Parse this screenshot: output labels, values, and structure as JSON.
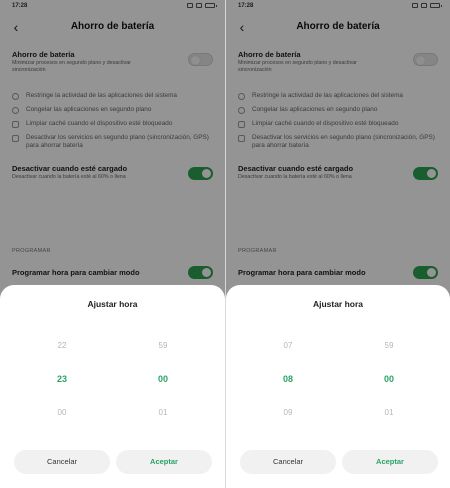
{
  "screens": [
    {
      "status_time": "17:28",
      "title": "Ahorro de batería",
      "setting_main": {
        "title": "Ahorro de batería",
        "subtitle": "Minimizar procesos en segundo plano y desactivar sincronización",
        "enabled": false
      },
      "features": [
        "Restringe la actividad de las aplicaciones del sistema",
        "Congelar las aplicaciones en segundo plano",
        "Limpiar caché cuando el dispositivo esté bloqueado",
        "Desactivar los servicios en segundo plano (sincronización, GPS) para ahorrar batería"
      ],
      "charged": {
        "title": "Desactivar cuando esté cargado",
        "subtitle": "Desactivar cuando la batería esté al 60% o llena",
        "enabled": true
      },
      "section": "PROGRAMAR",
      "schedule": {
        "title": "Programar hora para cambiar modo",
        "enabled": true
      },
      "sheet": {
        "title": "Ajustar hora",
        "hours": [
          "22",
          "23",
          "00"
        ],
        "minutes": [
          "59",
          "00",
          "01"
        ],
        "cancel": "Cancelar",
        "accept": "Aceptar"
      }
    },
    {
      "status_time": "17:28",
      "title": "Ahorro de batería",
      "setting_main": {
        "title": "Ahorro de batería",
        "subtitle": "Minimizar procesos en segundo plano y desactivar sincronización",
        "enabled": false
      },
      "features": [
        "Restringe la actividad de las aplicaciones del sistema",
        "Congelar las aplicaciones en segundo plano",
        "Limpiar caché cuando el dispositivo esté bloqueado",
        "Desactivar los servicios en segundo plano (sincronización, GPS) para ahorrar batería"
      ],
      "charged": {
        "title": "Desactivar cuando esté cargado",
        "subtitle": "Desactivar cuando la batería esté al 60% o llena",
        "enabled": true
      },
      "section": "PROGRAMAR",
      "schedule": {
        "title": "Programar hora para cambiar modo",
        "enabled": true
      },
      "sheet": {
        "title": "Ajustar hora",
        "hours": [
          "07",
          "08",
          "09"
        ],
        "minutes": [
          "59",
          "00",
          "01"
        ],
        "cancel": "Cancelar",
        "accept": "Aceptar"
      }
    }
  ],
  "colors": {
    "accent": "#2aa366",
    "toggle_on": "#2ea152",
    "overlay": "rgba(0,0,0,0.42)"
  }
}
